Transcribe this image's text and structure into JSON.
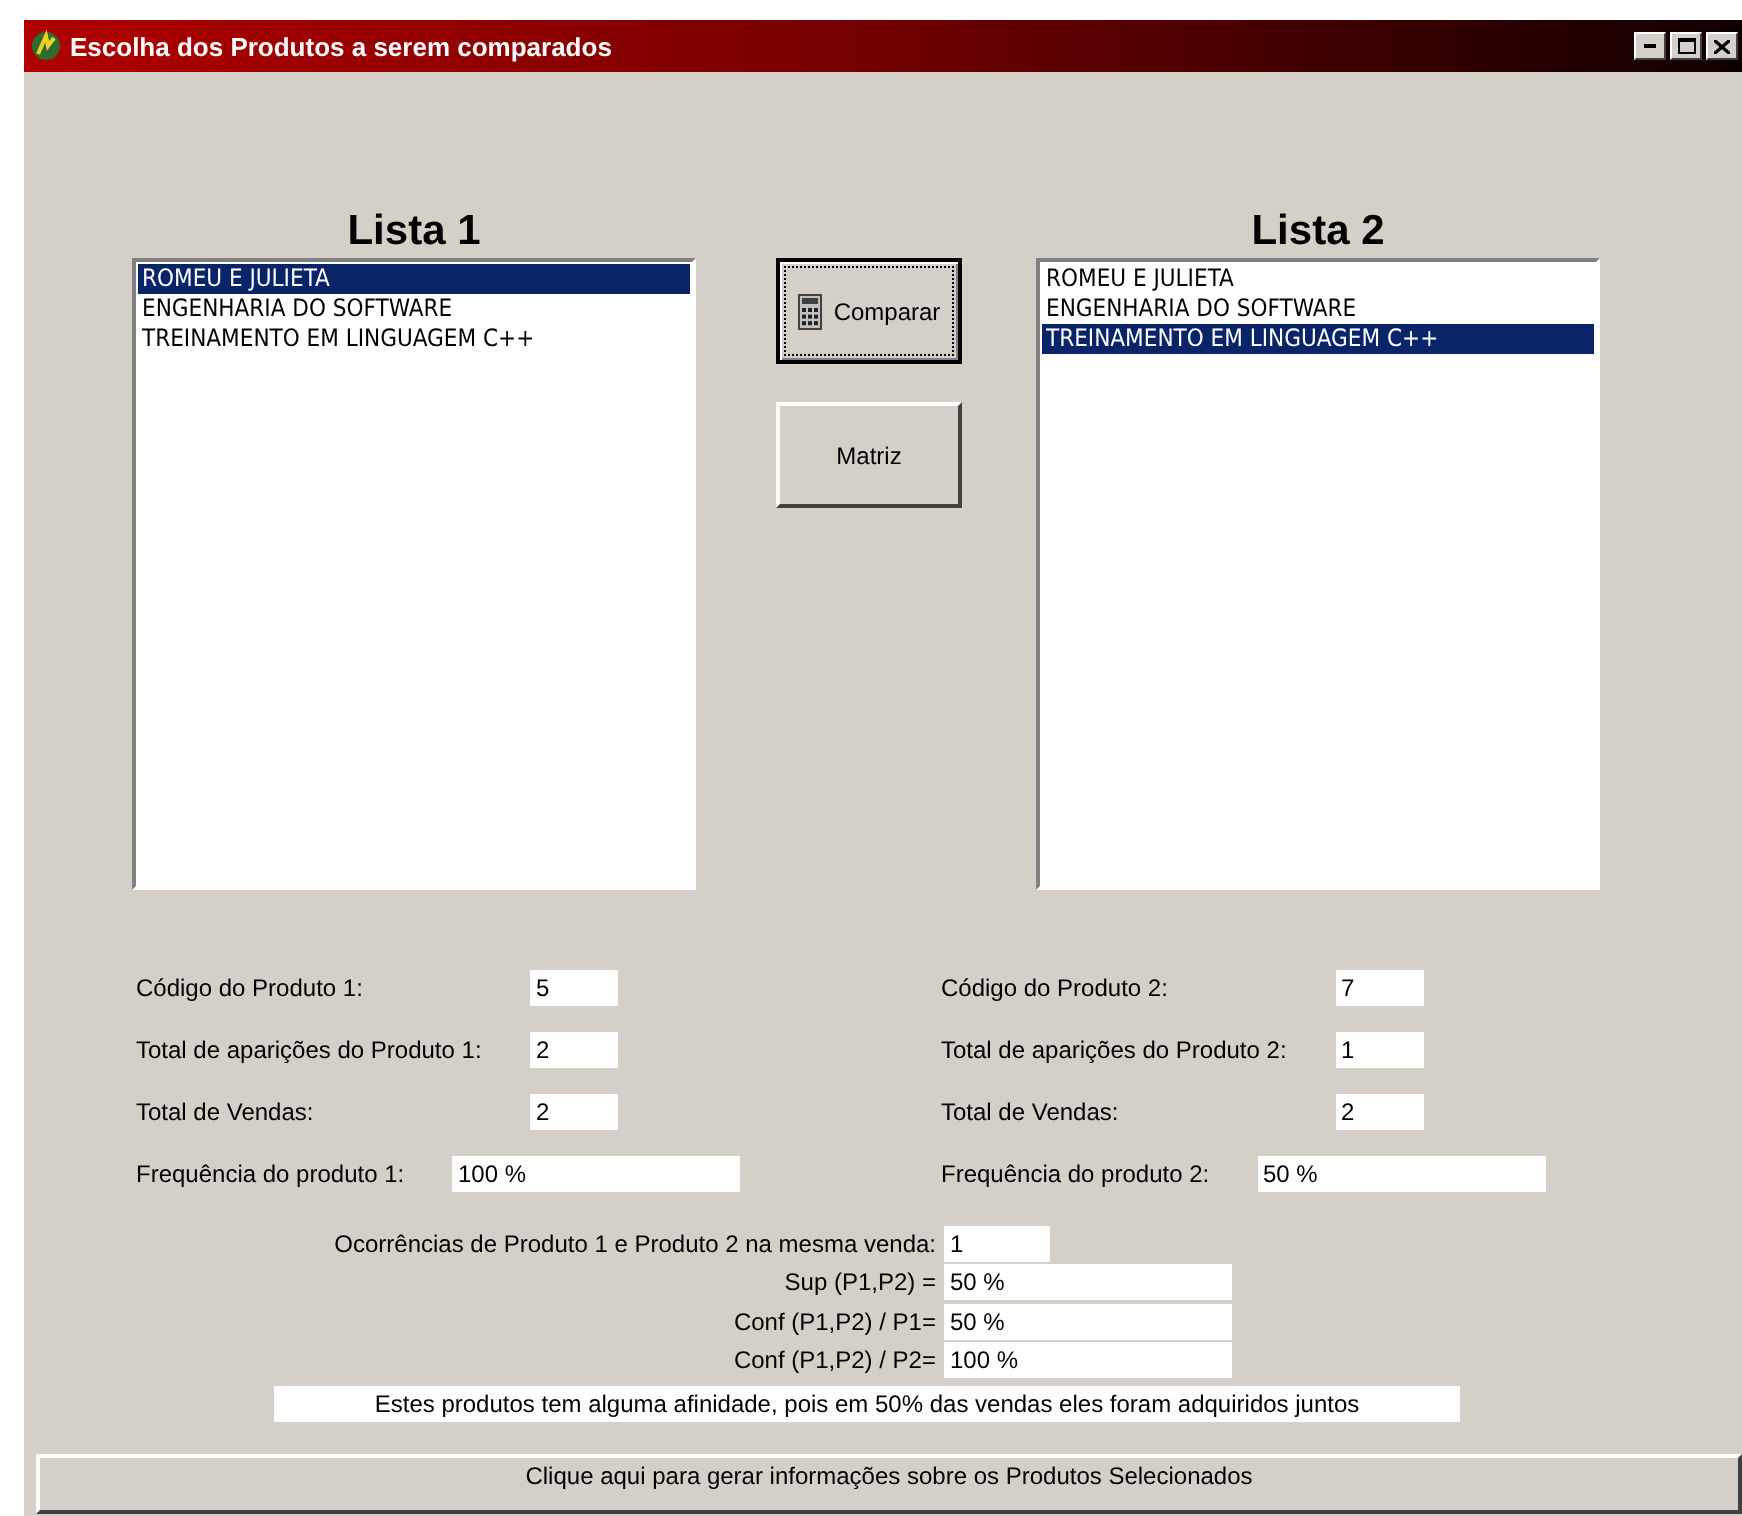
{
  "window": {
    "title": "Escolha dos Produtos a serem comparados"
  },
  "lists": [
    {
      "title": "Lista 1",
      "items": [
        {
          "label": "ROMEU E JULIETA",
          "selected": true
        },
        {
          "label": "ENGENHARIA DO SOFTWARE",
          "selected": false
        },
        {
          "label": "TREINAMENTO EM LINGUAGEM C++",
          "selected": false
        }
      ]
    },
    {
      "title": "Lista 2",
      "items": [
        {
          "label": "ROMEU E JULIETA",
          "selected": false
        },
        {
          "label": "ENGENHARIA DO SOFTWARE",
          "selected": false
        },
        {
          "label": "TREINAMENTO EM LINGUAGEM C++",
          "selected": true
        }
      ]
    }
  ],
  "buttons": [
    {
      "label": "Comparar",
      "kind": "calculator",
      "focused": true
    },
    {
      "label": "Matriz",
      "kind": "plain",
      "focused": false
    }
  ],
  "products": [
    {
      "fields": [
        {
          "label": "Código do Produto 1:",
          "value": "5",
          "kind": "short"
        },
        {
          "label": "Total de aparições do Produto 1:",
          "value": "2",
          "kind": "short"
        },
        {
          "label": "Total de Vendas:",
          "value": "2",
          "kind": "short"
        },
        {
          "label": "Frequência do produto 1:",
          "value": "100 %",
          "kind": "wide"
        }
      ]
    },
    {
      "fields": [
        {
          "label": "Código do Produto 2:",
          "value": "7",
          "kind": "short"
        },
        {
          "label": "Total de aparições do Produto 2:",
          "value": "1",
          "kind": "short"
        },
        {
          "label": "Total de Vendas:",
          "value": "2",
          "kind": "short"
        },
        {
          "label": "Frequência do produto 2:",
          "value": "50 %",
          "kind": "wide"
        }
      ]
    }
  ],
  "comparison": {
    "rows": [
      {
        "label": "Ocorrências de Produto 1 e Produto 2 na mesma venda:",
        "value": "1",
        "kind": "short"
      },
      {
        "label": "Sup (P1,P2) =",
        "value": "50 %",
        "kind": "wide"
      },
      {
        "label": "Conf (P1,P2) / P1=",
        "value": "50 %",
        "kind": "wide"
      },
      {
        "label": "Conf (P1,P2) / P2=",
        "value": "100 %",
        "kind": "wide"
      }
    ],
    "message": "Estes produtos tem alguma afinidade, pois em 50% das vendas eles foram adquiridos juntos"
  },
  "generate_button": {
    "label": "Clique aqui para gerar informações sobre os Produtos Selecionados"
  }
}
